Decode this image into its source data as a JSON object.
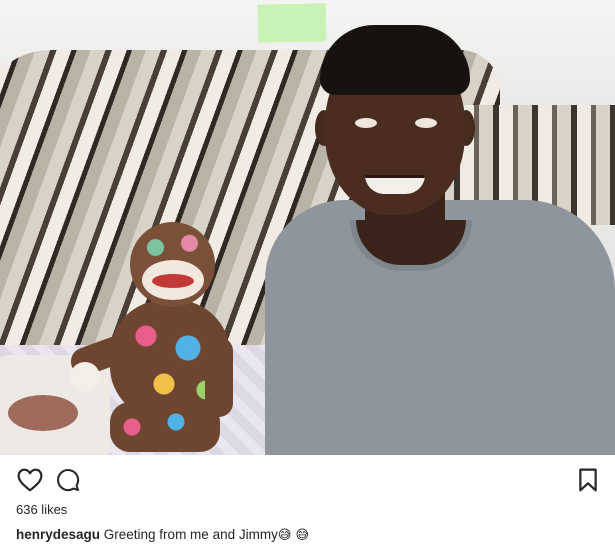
{
  "post": {
    "image": {
      "alt_semantic": "photo",
      "subjects": [
        "person",
        "sock-monkey-toy",
        "striped-sofa"
      ]
    },
    "actions": {
      "like_icon": "heart-outline-icon",
      "comment_icon": "comment-bubble-icon",
      "save_icon": "bookmark-outline-icon"
    },
    "likes_text": "636 likes",
    "caption": {
      "username": "henrydesagu",
      "text": " Greeting from me and Jimmy",
      "emoji": "😅 😅"
    },
    "colors": {
      "text": "#262626",
      "background": "#ffffff"
    }
  }
}
